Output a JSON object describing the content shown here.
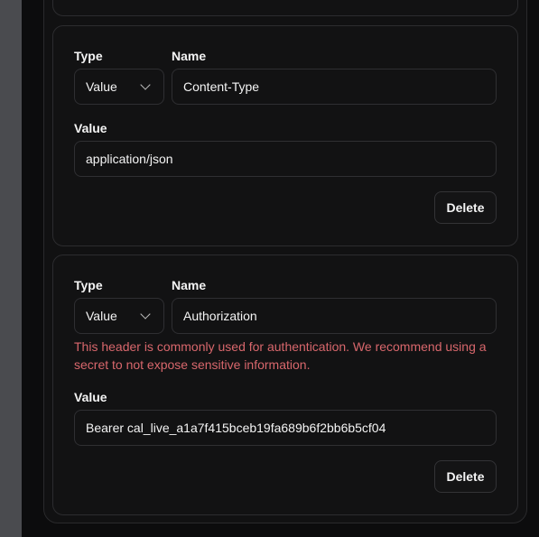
{
  "headers": [
    {
      "type_label": "Type",
      "type_value": "Value",
      "name_label": "Name",
      "name_value": "Content-Type",
      "value_label": "Value",
      "value_value": "application/json",
      "delete_label": "Delete"
    },
    {
      "type_label": "Type",
      "type_value": "Value",
      "name_label": "Name",
      "name_value": "Authorization",
      "warning": "This header is commonly used for authentication. We recommend using a secret to not expose sensitive information.",
      "value_label": "Value",
      "value_value": "Bearer cal_live_a1a7f415bceb19fa689b6f2bb6b5cf04",
      "delete_label": "Delete"
    }
  ],
  "colors": {
    "background": "#0c0c0d",
    "card": "#121213",
    "border": "#2f2f32",
    "warning": "#d8676c",
    "side_rail": "#4a4b4f"
  },
  "icons": {
    "select_chevron": "chevron-down-icon"
  }
}
